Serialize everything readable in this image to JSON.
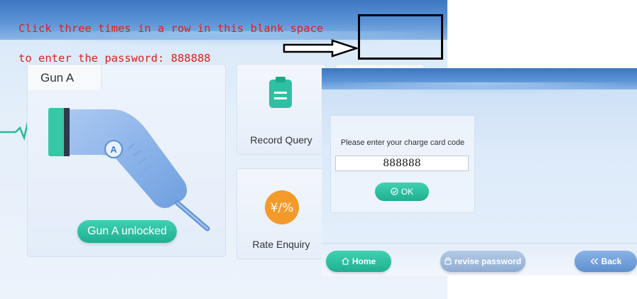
{
  "annotation": {
    "line1": "Click three times in a row in this blank space",
    "line2": "to enter the password: 888888"
  },
  "main_screen": {
    "gun_title": "Gun A",
    "gun_badge": "A",
    "gun_status_button": "Gun A unlocked",
    "record_query_label": "Record Query",
    "rate_enquiry_label": "Rate Enquiry",
    "rate_icon_glyph": "¥/%"
  },
  "dialog": {
    "prompt": "Please enter your charge card code",
    "code_value": "888888",
    "ok_label": "OK",
    "home_label": "Home",
    "revise_label": "revise password",
    "back_label": "Back"
  },
  "icons": {
    "ok": "check-circle-icon",
    "home": "home-icon",
    "revise": "lock-icon",
    "back": "double-chevron-left-icon"
  },
  "colors": {
    "header_blue": "#4a84cc",
    "accent_green": "#24b496",
    "annotation_red": "#e0211c",
    "back_blue": "#6e9bd8",
    "rate_orange": "#f39a2a"
  }
}
